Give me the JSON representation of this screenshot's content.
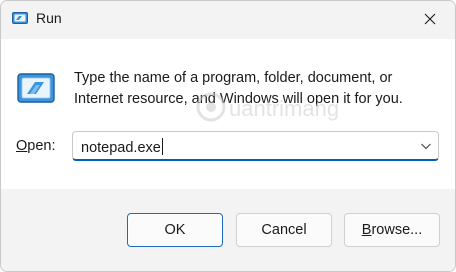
{
  "window": {
    "title": "Run",
    "icon": "run-icon",
    "close_icon": "close-icon"
  },
  "dialog": {
    "description_line1": "Type the name of a program, folder, document, or",
    "description_line2": "Internet resource, and Windows will open it for you.",
    "icon": "run-icon",
    "watermark_text": "Quantrimang"
  },
  "open_field": {
    "label_prefix": "",
    "label_accel": "O",
    "label_rest": "pen:",
    "value": "notepad.exe",
    "dropdown_icon": "chevron-down-icon"
  },
  "buttons": {
    "ok": "OK",
    "cancel": "Cancel",
    "browse_accel": "B",
    "browse_rest": "rowse..."
  },
  "colors": {
    "accent": "#005fb8",
    "window_bg": "#f3f3f3",
    "content_bg": "#ffffff"
  }
}
